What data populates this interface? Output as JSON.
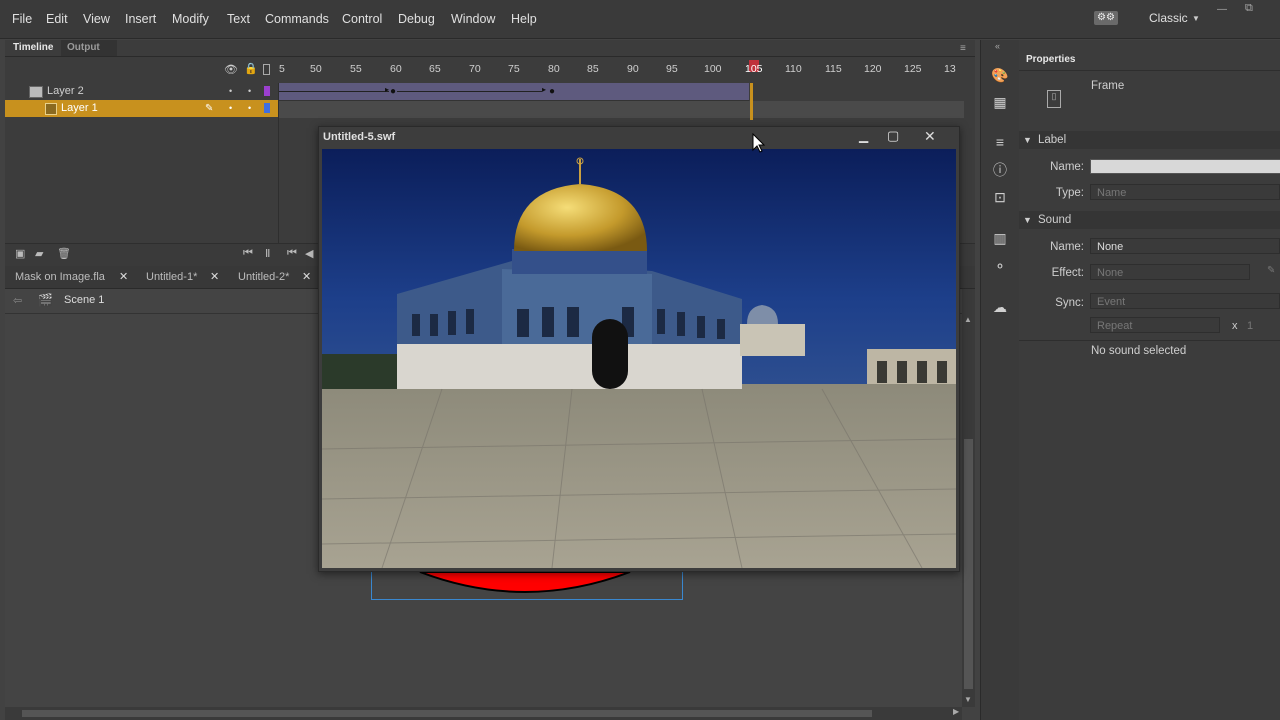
{
  "menu": {
    "items": [
      "File",
      "Edit",
      "View",
      "Insert",
      "Modify",
      "Text",
      "Commands",
      "Control",
      "Debug",
      "Window",
      "Help"
    ],
    "workspace": "Classic"
  },
  "timeline": {
    "tab_timeline": "Timeline",
    "tab_output": "Output",
    "ruler": [
      "5",
      "50",
      "55",
      "60",
      "65",
      "70",
      "75",
      "80",
      "85",
      "90",
      "95",
      "100",
      "105",
      "110",
      "115",
      "120",
      "125",
      "13"
    ],
    "layers": [
      {
        "name": "Layer 2",
        "selected": false,
        "color": "#9b3fd0"
      },
      {
        "name": "Layer 1",
        "selected": true,
        "color": "#3f6fe0"
      }
    ],
    "playhead_frame": "105"
  },
  "docs": {
    "tabs": [
      "Mask on Image.fla",
      "Untitled-1*",
      "Untitled-2*"
    ],
    "scene": "Scene 1"
  },
  "swf_window": {
    "title": "Untitled-5.swf"
  },
  "properties": {
    "panel_title": "Properties",
    "object_type": "Frame",
    "label_section": "Label",
    "name_label": "Name:",
    "name_value": "",
    "type_label": "Type:",
    "type_value": "Name",
    "sound_section": "Sound",
    "sound_name_label": "Name:",
    "sound_name_value": "None",
    "effect_label": "Effect:",
    "effect_value": "None",
    "sync_label": "Sync:",
    "sync_value": "Event",
    "repeat_value": "Repeat",
    "repeat_x": "x",
    "repeat_count": "1",
    "no_sound": "No sound selected"
  },
  "colors": {
    "accent": "#c8911e",
    "playhead": "#e04040",
    "mask_fill": "#ff0000"
  }
}
